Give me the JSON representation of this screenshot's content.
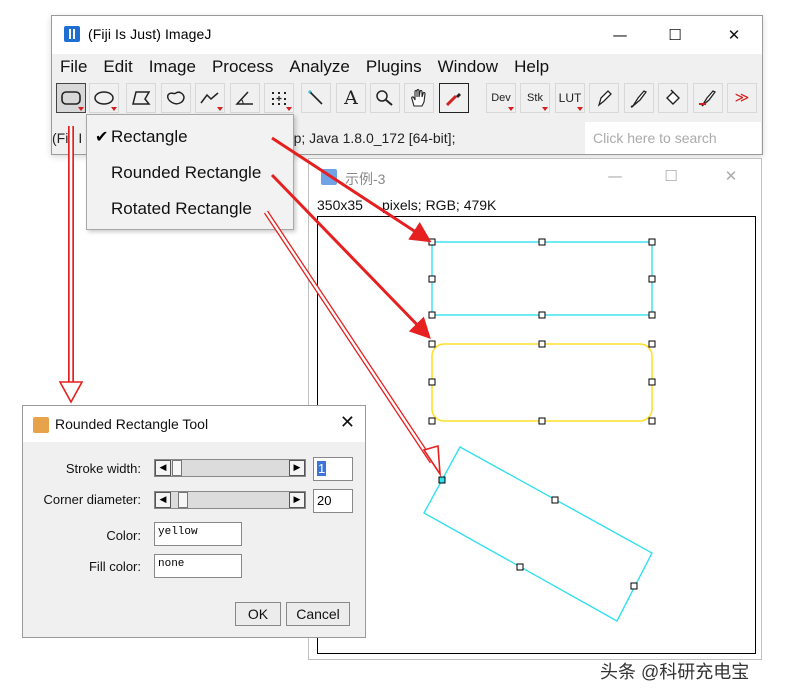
{
  "main_window": {
    "title": "(Fiji Is Just) ImageJ",
    "minimize": "—",
    "maximize": "☐",
    "close": "✕",
    "menu": [
      "File",
      "Edit",
      "Image",
      "Process",
      "Analyze",
      "Plugins",
      "Window",
      "Help"
    ],
    "tools": {
      "dev": "Dev",
      "stk": "Stk",
      "lut": "LUT",
      "text": "A",
      "more": "≫"
    },
    "status_prefix": "(Fiji I",
    "status_suffix": "52p; Java 1.8.0_172 [64-bit];",
    "search_placeholder": "Click here to search"
  },
  "popup_menu": {
    "checkmark": "✔",
    "items": [
      "Rectangle",
      "Rounded Rectangle",
      "Rotated Rectangle"
    ]
  },
  "image_window": {
    "title": "示例-3",
    "minimize": "—",
    "maximize": "☐",
    "close": "✕",
    "info_prefix": "350x35",
    "info_suffix": "pixels; RGB; 479K"
  },
  "dialog": {
    "title": "Rounded Rectangle Tool",
    "close": "✕",
    "stroke_width_label": "Stroke width:",
    "stroke_width_value": "1",
    "corner_diameter_label": "Corner diameter:",
    "corner_diameter_value": "20",
    "color_label": "Color:",
    "color_value": "yellow",
    "fill_label": "Fill color:",
    "fill_value": "none",
    "ok": "OK",
    "cancel": "Cancel",
    "arrow_left": "◀",
    "arrow_right": "▶"
  },
  "watermark": "头条 @科研充电宝",
  "colors": {
    "cyan_roi": "#33e0ee",
    "yellow_roi": "#ffe02a",
    "arrow_red": "#e62020"
  }
}
